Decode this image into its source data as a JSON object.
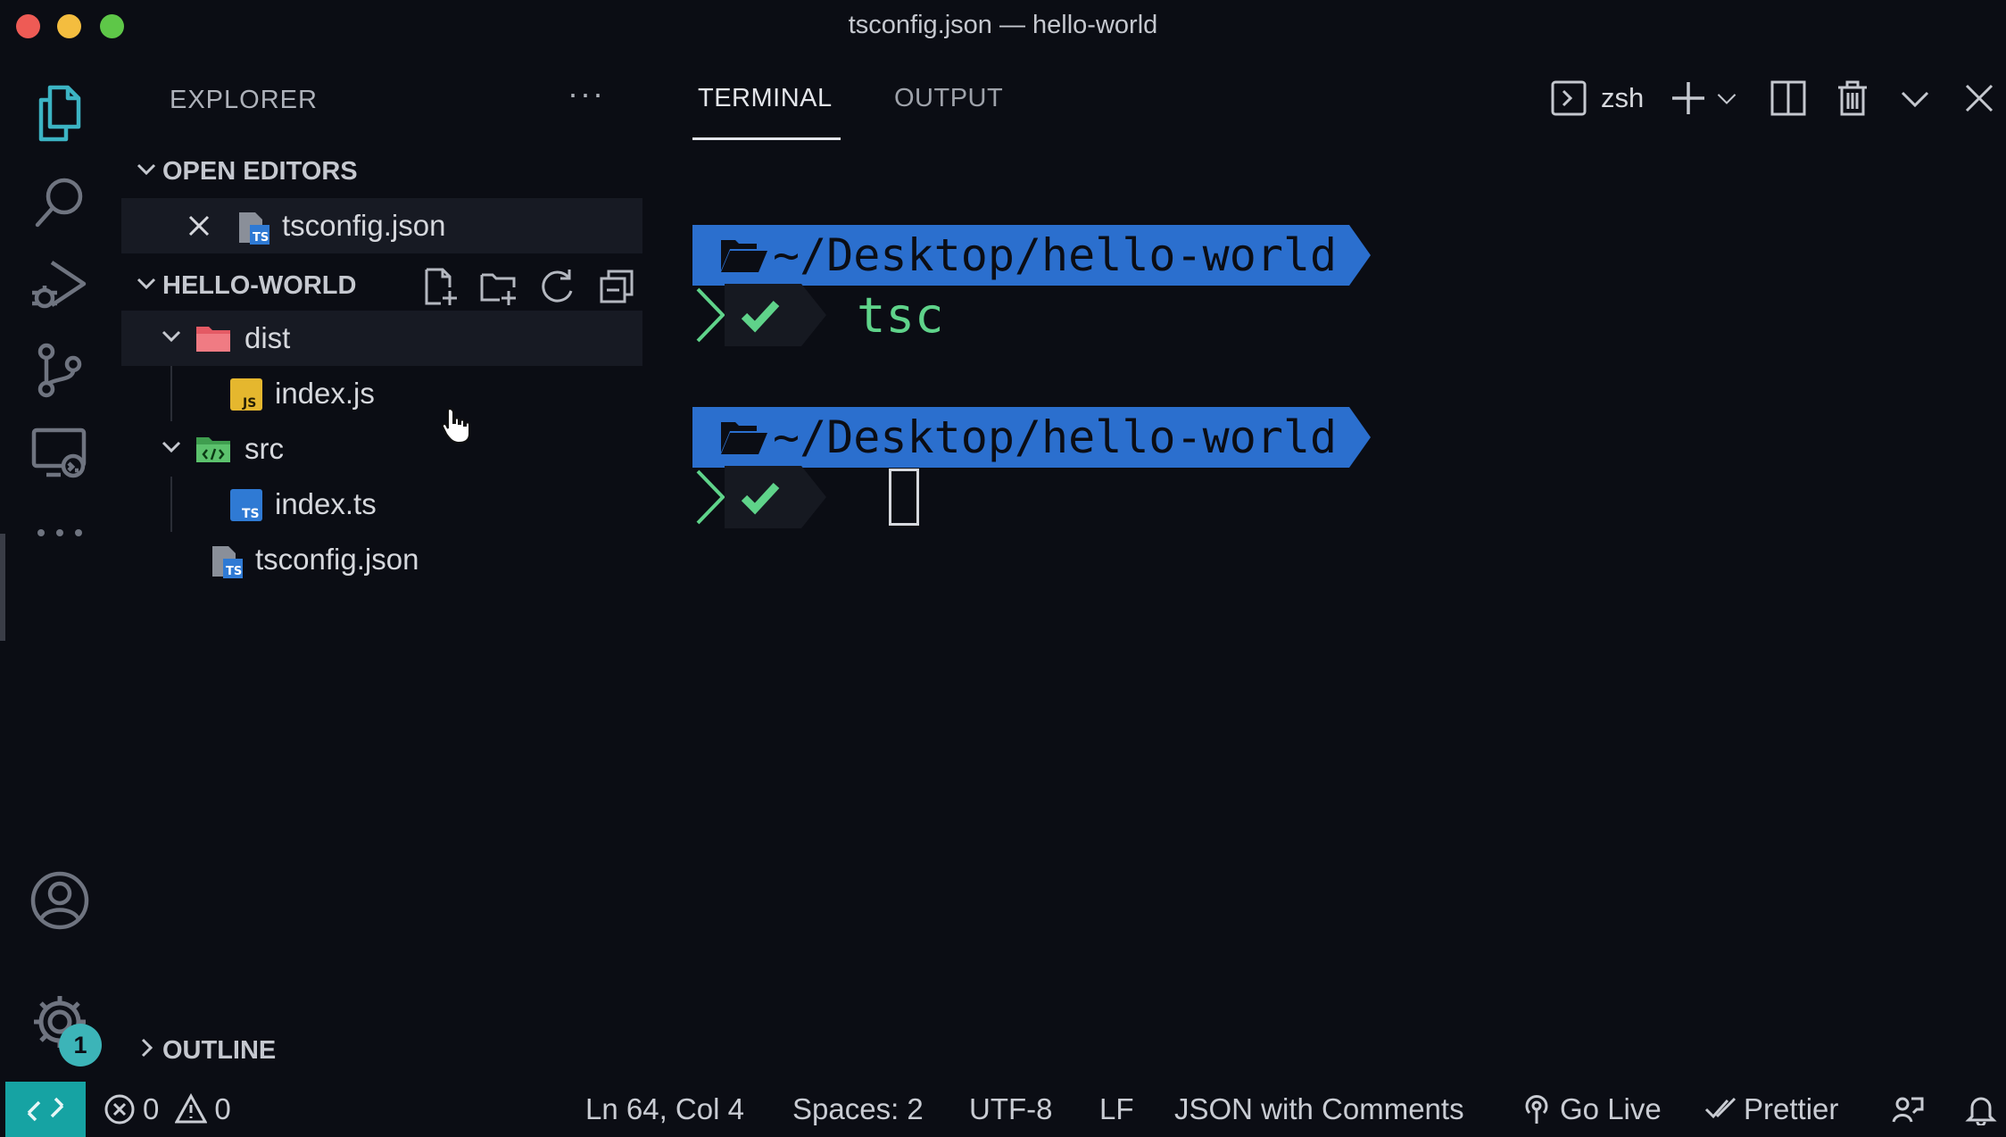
{
  "window": {
    "title": "tsconfig.json — hello-world"
  },
  "sidebar": {
    "title": "EXPLORER",
    "more": "···",
    "open_editors": {
      "label": "OPEN EDITORS",
      "items": [
        {
          "name": "tsconfig.json",
          "icon": "ts-config-file-icon"
        }
      ]
    },
    "project": {
      "label": "HELLO-WORLD",
      "tree": [
        {
          "name": "dist",
          "type": "folder",
          "expanded": true
        },
        {
          "name": "index.js",
          "type": "file",
          "badge": "JS"
        },
        {
          "name": "src",
          "type": "folder",
          "expanded": true
        },
        {
          "name": "index.ts",
          "type": "file",
          "badge": "TS"
        },
        {
          "name": "tsconfig.json",
          "type": "file",
          "badge": "TS"
        }
      ]
    },
    "outline": {
      "label": "OUTLINE"
    }
  },
  "panel": {
    "tabs": [
      {
        "label": "TERMINAL",
        "active": true
      },
      {
        "label": "OUTPUT",
        "active": false
      }
    ],
    "shell": "zsh"
  },
  "terminal": {
    "blocks": [
      {
        "path": "~/Desktop/hello-world",
        "command": "tsc"
      },
      {
        "path": "~/Desktop/hello-world",
        "command": ""
      }
    ]
  },
  "activity": {
    "settings_badge": "1"
  },
  "statusbar": {
    "errors": "0",
    "warnings": "0",
    "position": "Ln 64, Col 4",
    "spaces": "Spaces: 2",
    "encoding": "UTF-8",
    "eol": "LF",
    "language": "JSON with Comments",
    "go_live": "Go Live",
    "prettier": "Prettier"
  },
  "colors": {
    "background": "#0b0d14",
    "path_bg": "#2b6fce",
    "prompt_green": "#5fd38a",
    "remote_teal": "#16a3a3",
    "ts_blue": "#2f7ad4",
    "js_yellow": "#e5b72e"
  }
}
